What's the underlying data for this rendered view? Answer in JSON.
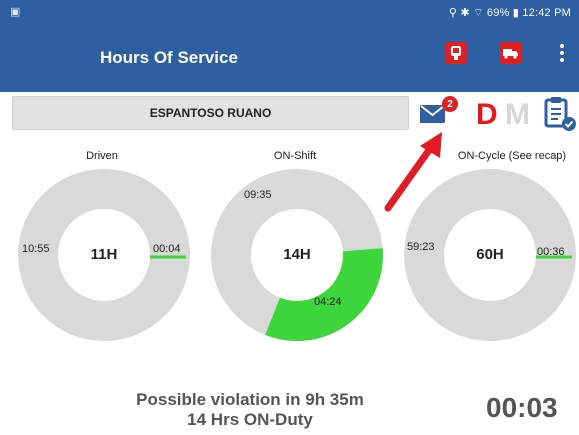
{
  "status_bar": {
    "app_icon": "notification-icon",
    "right_text": "69%",
    "time": "12:42 PM"
  },
  "app_bar": {
    "title": "Hours Of Service"
  },
  "driver": {
    "name": "ESPANTOSO RUANO"
  },
  "messages": {
    "unread_count": "2"
  },
  "duty_status": {
    "current": "D",
    "other": "M"
  },
  "gauges": [
    {
      "label": "Driven",
      "center": "11H",
      "used": "10:55",
      "remaining": "00:04",
      "fraction_used": 0.994,
      "accent": "#3cd63c"
    },
    {
      "label": "ON-Shift",
      "center": "14H",
      "used": "09:35",
      "remaining": "04:24",
      "fraction_used": 0.685,
      "accent": "#3cd63c"
    },
    {
      "label": "ON-Cycle (See recap)",
      "center": "60H",
      "used": "59:23",
      "remaining": "00:36",
      "fraction_used": 0.99,
      "accent": "#3cd63c"
    }
  ],
  "violation": {
    "line1": "Possible violation in 9h 35m",
    "line2": "14 Hrs ON-Duty"
  },
  "timer": "00:03",
  "colors": {
    "primary": "#2f5fa3",
    "alert": "#e61919",
    "green": "#3cd63c",
    "gray": "#d9d9d9"
  }
}
